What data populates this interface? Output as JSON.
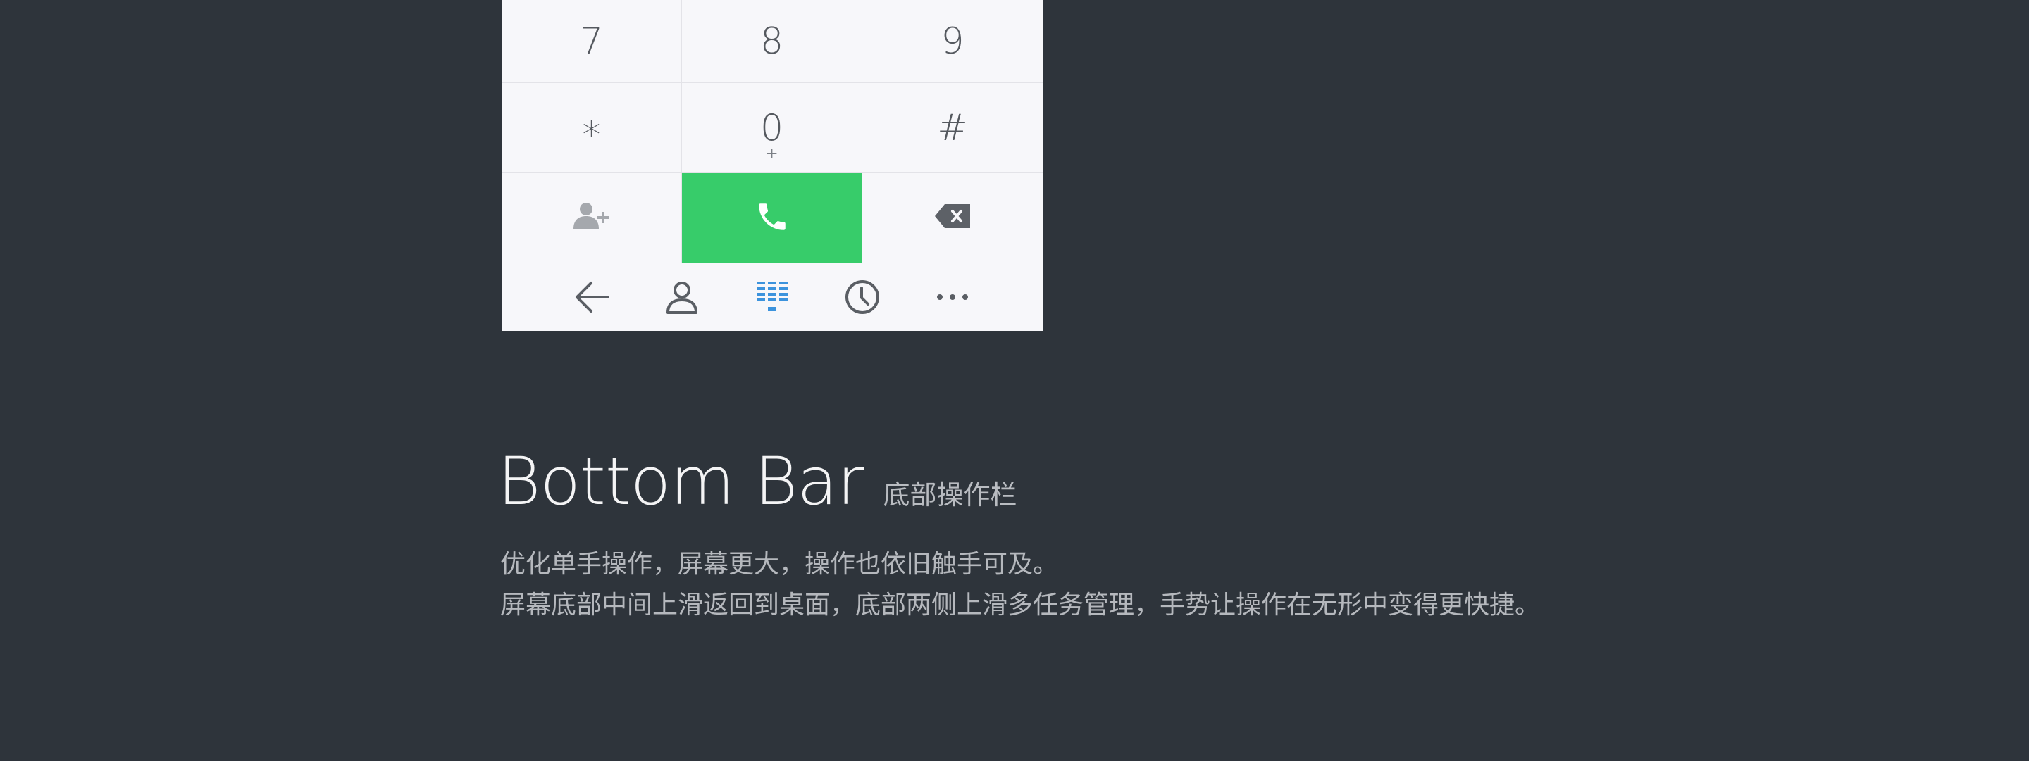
{
  "keypad": {
    "rows": [
      [
        {
          "digit": "7",
          "sub": ""
        },
        {
          "digit": "8",
          "sub": ""
        },
        {
          "digit": "9",
          "sub": ""
        }
      ],
      [
        {
          "digit": "∗",
          "sub": ""
        },
        {
          "digit": "0",
          "sub": "+"
        },
        {
          "digit": "#",
          "sub": ""
        }
      ]
    ],
    "actions": {
      "add_contact_icon": "add-contact-icon",
      "call_icon": "phone-icon",
      "delete_icon": "backspace-icon"
    },
    "call_color": "#37cc6a"
  },
  "bottom_bar": {
    "icons": [
      "back-arrow-icon",
      "contacts-icon",
      "dialpad-icon",
      "recent-calls-icon",
      "more-icon"
    ],
    "active_index": 2,
    "active_color": "#3c93dd"
  },
  "section": {
    "title": "Bottom Bar",
    "subtitle": "底部操作栏",
    "description_line1": "优化单手操作，屏幕更大，操作也依旧触手可及。",
    "description_line2": "屏幕底部中间上滑返回到桌面，底部两侧上滑多任务管理，手势让操作在无形中变得更快捷。"
  },
  "colors": {
    "background": "#2e343b",
    "panel": "#f7f7fa"
  }
}
